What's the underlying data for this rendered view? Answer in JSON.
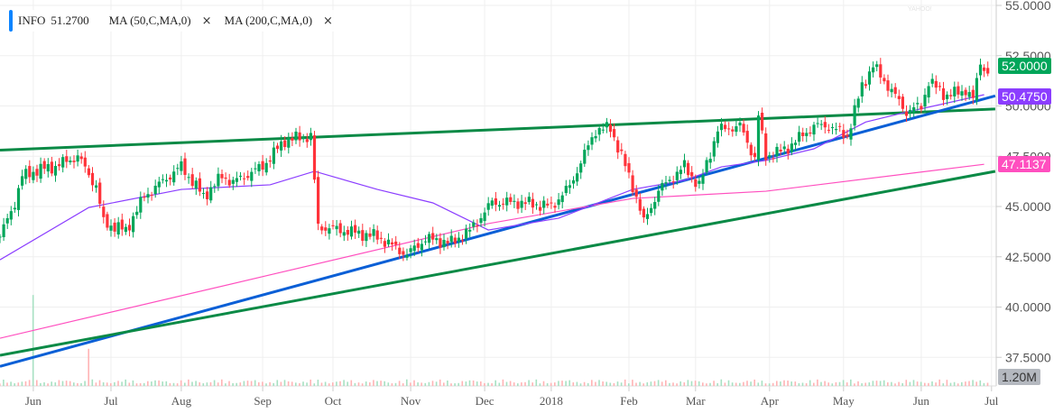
{
  "legend": {
    "symbol": "INFO",
    "last": "51.2700",
    "ma1": "MA (50,C,MA,0)",
    "ma2": "MA (200,C,MA,0)",
    "close_glyph": "×"
  },
  "watermark": "YAHOO! FINANCE",
  "badges": {
    "last_price": "52.0000",
    "ma50": "50.4750",
    "ma200": "47.1137",
    "volume": "1.20M"
  },
  "colors": {
    "up": "#00a65a",
    "down": "#ff333a",
    "ma50": "#8b3dff",
    "ma200": "#ff4fbf",
    "trend_green": "#0a8a46",
    "trend_blue": "#0a5fd6",
    "accent": "#0b84ff"
  },
  "chart_data": {
    "type": "candlestick",
    "title": "INFO",
    "ylim": [
      36.25,
      55.2
    ],
    "y_ticks": [
      "55.0000",
      "52.5000",
      "50.0000",
      "47.5000",
      "45.0000",
      "42.5000",
      "40.0000",
      "37.5000"
    ],
    "y_tick_values": [
      55,
      52.5,
      50,
      47.5,
      45,
      42.5,
      40,
      37.5
    ],
    "x_range_days": [
      0,
      269
    ],
    "x_ticks": [
      {
        "label": "Jun",
        "day": 9
      },
      {
        "label": "Jul",
        "day": 30
      },
      {
        "label": "Aug",
        "day": 49
      },
      {
        "label": "Sep",
        "day": 71
      },
      {
        "label": "Oct",
        "day": 90
      },
      {
        "label": "Nov",
        "day": 111
      },
      {
        "label": "Dec",
        "day": 131
      },
      {
        "label": "2018",
        "day": 149
      },
      {
        "label": "Feb",
        "day": 170
      },
      {
        "label": "Mar",
        "day": 188
      },
      {
        "label": "Apr",
        "day": 208
      },
      {
        "label": "May",
        "day": 228
      },
      {
        "label": "Jun",
        "day": 249
      },
      {
        "label": "Jul",
        "day": 268
      }
    ],
    "price_path": [
      [
        0,
        43.5
      ],
      [
        4,
        45.2
      ],
      [
        6,
        46.5
      ],
      [
        10,
        46.8
      ],
      [
        15,
        47
      ],
      [
        21,
        47.5
      ],
      [
        26,
        46
      ],
      [
        28,
        44.2
      ],
      [
        34,
        43.8
      ],
      [
        39,
        45.5
      ],
      [
        49,
        47
      ],
      [
        55,
        45.5
      ],
      [
        60,
        46.5
      ],
      [
        63,
        46.2
      ],
      [
        71,
        47
      ],
      [
        77,
        48.3
      ],
      [
        84,
        48.5
      ],
      [
        86,
        44
      ],
      [
        93,
        43.8
      ],
      [
        102,
        43.5
      ],
      [
        110,
        42.6
      ],
      [
        115,
        43.4
      ],
      [
        122,
        43.2
      ],
      [
        127,
        43.8
      ],
      [
        133,
        45.2
      ],
      [
        141,
        45.2
      ],
      [
        149,
        45
      ],
      [
        154,
        46
      ],
      [
        161,
        48.8
      ],
      [
        165,
        48.9
      ],
      [
        168,
        47.5
      ],
      [
        172,
        45.5
      ],
      [
        174,
        44.2
      ],
      [
        178,
        45.8
      ],
      [
        185,
        47
      ],
      [
        189,
        46
      ],
      [
        194,
        48.8
      ],
      [
        200,
        49
      ],
      [
        204,
        47.4
      ],
      [
        205,
        49.5
      ],
      [
        207,
        47.5
      ],
      [
        212,
        47.8
      ],
      [
        220,
        49
      ],
      [
        224,
        49
      ],
      [
        229,
        48.5
      ],
      [
        233,
        51
      ],
      [
        236,
        52
      ],
      [
        240,
        51
      ],
      [
        245,
        49.7
      ],
      [
        249,
        50
      ],
      [
        251,
        51.2
      ],
      [
        256,
        50.5
      ],
      [
        261,
        50.8
      ],
      [
        263,
        50.3
      ],
      [
        265,
        52.2
      ],
      [
        267,
        51.6
      ]
    ],
    "ma50": [
      [
        0,
        42.35
      ],
      [
        24,
        44.95
      ],
      [
        49,
        45.85
      ],
      [
        73,
        46.08
      ],
      [
        85,
        46.75
      ],
      [
        102,
        45.85
      ],
      [
        117,
        45.18
      ],
      [
        132,
        43.83
      ],
      [
        151,
        44.42
      ],
      [
        171,
        45.85
      ],
      [
        185,
        46.3
      ],
      [
        195,
        46.97
      ],
      [
        207,
        47.29
      ],
      [
        220,
        47.87
      ],
      [
        234,
        49.2
      ],
      [
        244,
        49.65
      ],
      [
        266,
        50.56
      ]
    ],
    "ma200": [
      [
        0,
        38.45
      ],
      [
        73,
        41.6
      ],
      [
        132,
        44.15
      ],
      [
        171,
        45.4
      ],
      [
        207,
        45.76
      ],
      [
        266,
        47.1
      ]
    ],
    "trendlines": [
      {
        "name": "upper-resistance",
        "color": "green",
        "from": [
          0,
          47.8
        ],
        "to": [
          269,
          49.85
        ]
      },
      {
        "name": "blue-support",
        "color": "blue",
        "from": [
          0,
          37.05
        ],
        "to": [
          269,
          50.5
        ]
      },
      {
        "name": "lower-support",
        "color": "green",
        "from": [
          0,
          37.6
        ],
        "to": [
          269,
          46.75
        ]
      }
    ],
    "volume_spikes": [
      [
        9,
        1.1
      ],
      [
        24,
        0.45
      ]
    ],
    "volume_max_label": "1.20M"
  }
}
